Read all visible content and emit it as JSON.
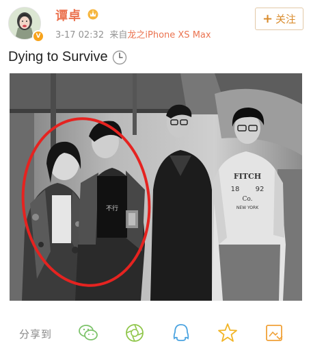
{
  "post": {
    "username": "谭卓",
    "timestamp": "3-17 02:32",
    "source_prefix": "来自",
    "source": "龙之iPhone XS Max",
    "follow_label": "关注",
    "text": "Dying to Survive",
    "verified_badge": "V"
  },
  "photo": {
    "shirt_text": "FITCH",
    "shirt_numbers_left": "18",
    "shirt_numbers_right": "92",
    "shirt_co": "Co.",
    "shirt_bottom": "NEW YORK",
    "tee_text": "不行"
  },
  "share": {
    "label": "分享到",
    "icons": [
      "wechat-icon",
      "moments-icon",
      "qq-icon",
      "qzone-icon",
      "save-icon"
    ]
  },
  "colors": {
    "username": "#eb7350",
    "follow_border": "#e2c8a6",
    "follow_text": "#d98b2c",
    "highlight_circle": "#e52320",
    "share_green": "#7cc36a",
    "share_blue": "#4aa3e0",
    "share_gold": "#f2b527",
    "share_orange": "#f0a137"
  }
}
